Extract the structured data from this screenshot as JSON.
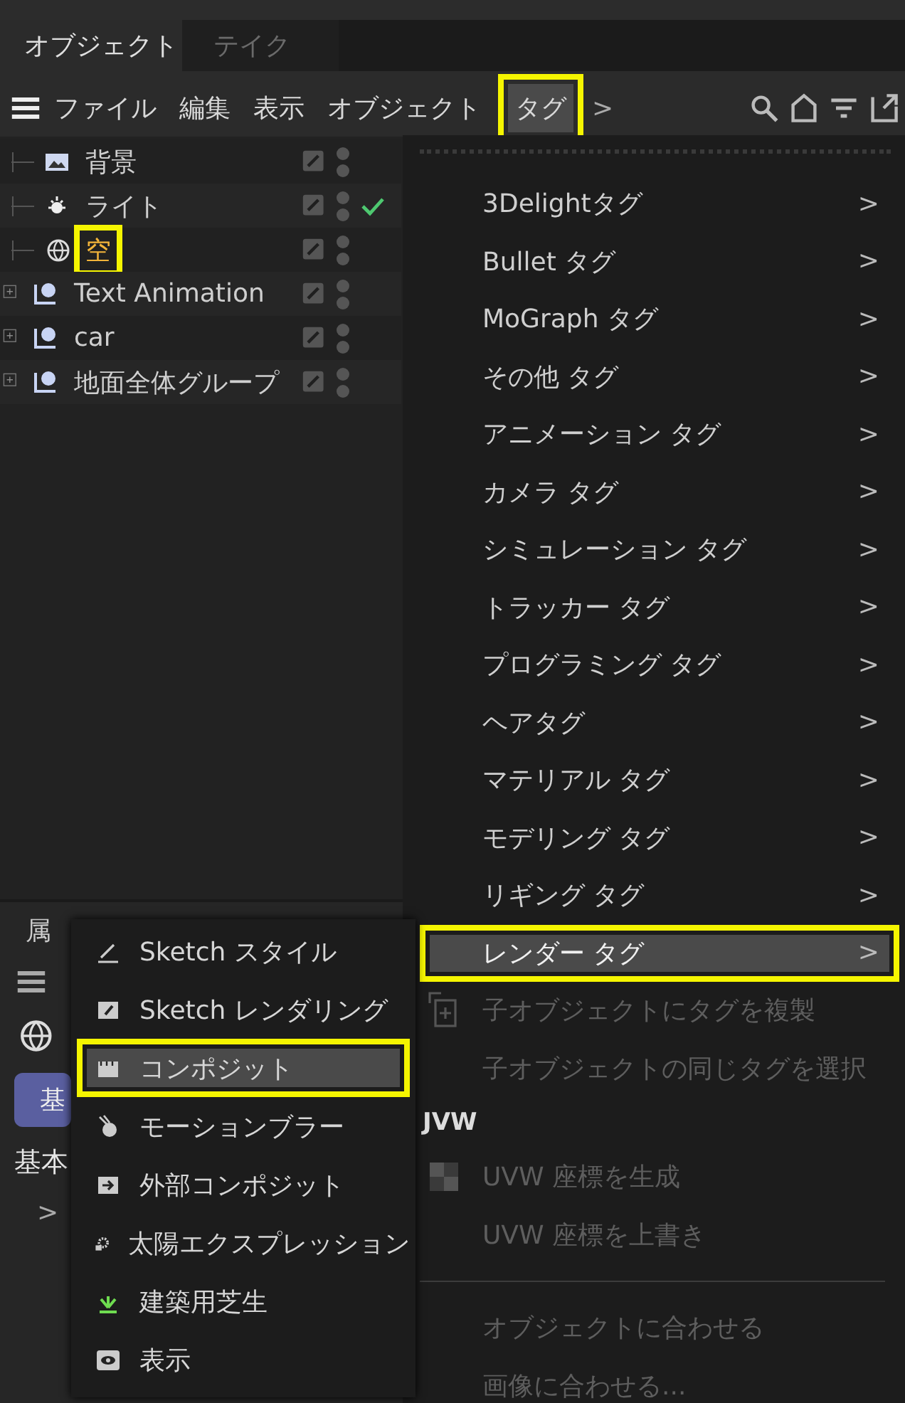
{
  "tabs": [
    {
      "label": "オブジェクト",
      "selected": true
    },
    {
      "label": "テイク",
      "selected": false
    }
  ],
  "menubar": {
    "items": [
      {
        "label": "ファイル",
        "selected": false,
        "annotated": false
      },
      {
        "label": "編集",
        "selected": false,
        "annotated": false
      },
      {
        "label": "表示",
        "selected": false,
        "annotated": false
      },
      {
        "label": "オブジェクト",
        "selected": false,
        "annotated": false
      },
      {
        "label": "タグ",
        "selected": true,
        "annotated": true
      }
    ],
    "more": ">"
  },
  "tree": [
    {
      "label": "背景",
      "kind": "leaf",
      "selected": false,
      "check": false,
      "annotated": false
    },
    {
      "label": "ライト",
      "kind": "leaf",
      "selected": false,
      "check": true,
      "annotated": false
    },
    {
      "label": "空",
      "kind": "leaf",
      "selected": true,
      "check": false,
      "annotated": true
    },
    {
      "label": "Text Animation",
      "kind": "group",
      "expanded": false,
      "selected": false,
      "check": false,
      "annotated": false
    },
    {
      "label": "car",
      "kind": "group",
      "expanded": false,
      "selected": false,
      "check": false,
      "annotated": false
    },
    {
      "label": "地面全体グループ",
      "kind": "group",
      "expanded": false,
      "selected": false,
      "check": false,
      "annotated": false
    }
  ],
  "attributes": {
    "tab": "属",
    "mode_button": "基",
    "section": "基本",
    "expander": ">"
  },
  "tag_menu": {
    "items": [
      {
        "kind": "submenu",
        "label": "3Delightタグ",
        "chevron": ">",
        "selected": false,
        "annotated": false
      },
      {
        "kind": "submenu",
        "label": "Bullet タグ",
        "chevron": ">",
        "selected": false,
        "annotated": false
      },
      {
        "kind": "submenu",
        "label": "MoGraph タグ",
        "chevron": ">",
        "selected": false,
        "annotated": false
      },
      {
        "kind": "submenu",
        "label": "その他 タグ",
        "chevron": ">",
        "selected": false,
        "annotated": false
      },
      {
        "kind": "submenu",
        "label": "アニメーション タグ",
        "chevron": ">",
        "selected": false,
        "annotated": false
      },
      {
        "kind": "submenu",
        "label": "カメラ タグ",
        "chevron": ">",
        "selected": false,
        "annotated": false
      },
      {
        "kind": "submenu",
        "label": "シミュレーション タグ",
        "chevron": ">",
        "selected": false,
        "annotated": false
      },
      {
        "kind": "submenu",
        "label": "トラッカー タグ",
        "chevron": ">",
        "selected": false,
        "annotated": false
      },
      {
        "kind": "submenu",
        "label": "プログラミング タグ",
        "chevron": ">",
        "selected": false,
        "annotated": false
      },
      {
        "kind": "submenu",
        "label": "ヘアタグ",
        "chevron": ">",
        "selected": false,
        "annotated": false
      },
      {
        "kind": "submenu",
        "label": "マテリアル タグ",
        "chevron": ">",
        "selected": false,
        "annotated": false
      },
      {
        "kind": "submenu",
        "label": "モデリング タグ",
        "chevron": ">",
        "selected": false,
        "annotated": false
      },
      {
        "kind": "submenu",
        "label": "リギング タグ",
        "chevron": ">",
        "selected": false,
        "annotated": false
      },
      {
        "kind": "submenu",
        "label": "レンダー タグ",
        "chevron": ">",
        "selected": true,
        "annotated": true
      },
      {
        "kind": "action",
        "label": "子オブジェクトにタグを複製",
        "disabled": true,
        "icon": true
      },
      {
        "kind": "action",
        "label": "子オブジェクトの同じタグを選択",
        "disabled": true,
        "icon": false
      },
      {
        "kind": "heading",
        "label": "JVW"
      },
      {
        "kind": "action",
        "label": "UVW 座標を生成",
        "disabled": true,
        "icon": true
      },
      {
        "kind": "action",
        "label": "UVW 座標を上書き",
        "disabled": true,
        "icon": false
      },
      {
        "kind": "separator"
      },
      {
        "kind": "action",
        "label": "オブジェクトに合わせる",
        "disabled": true,
        "icon": false
      },
      {
        "kind": "action",
        "label": "画像に合わせる...",
        "disabled": true,
        "icon": false
      }
    ]
  },
  "render_submenu": {
    "items": [
      {
        "label": "Sketch スタイル",
        "selected": false,
        "annotated": false
      },
      {
        "label": "Sketch レンダリング",
        "selected": false,
        "annotated": false
      },
      {
        "label": "コンポジット",
        "selected": true,
        "annotated": true
      },
      {
        "label": "モーションブラー",
        "selected": false,
        "annotated": false
      },
      {
        "label": "外部コンポジット",
        "selected": false,
        "annotated": false
      },
      {
        "label": "太陽エクスプレッション",
        "selected": false,
        "annotated": false
      },
      {
        "label": "建築用芝生",
        "selected": false,
        "annotated": false
      },
      {
        "label": "表示",
        "selected": false,
        "annotated": false
      }
    ]
  }
}
